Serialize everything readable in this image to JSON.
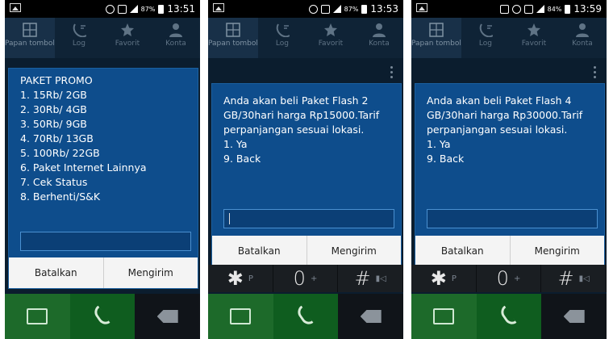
{
  "phones": [
    {
      "status": {
        "battery": "87%",
        "time": "13:51"
      },
      "tabs": [
        "Papan tombol",
        "Log",
        "Favorit",
        "Konta"
      ],
      "dialog": {
        "message": "PAKET PROMO\n1. 15Rb/ 2GB\n2. 30Rb/ 4GB\n3. 50Rb/ 9GB\n4. 70Rb/ 13GB\n5. 100Rb/ 22GB\n6. Paket Internet Lainnya\n7. Cek Status\n8. Berhenti/S&K",
        "input_value": "",
        "cancel_label": "Batalkan",
        "send_label": "Mengirim"
      }
    },
    {
      "status": {
        "battery": "87%",
        "time": "13:53"
      },
      "tabs": [
        "Papan tombol",
        "Log",
        "Favorit",
        "Konta"
      ],
      "dialog": {
        "message": "Anda akan beli Paket Flash 2 GB/30hari harga Rp15000.Tarif perpanjangan sesuai lokasi.\n1. Ya\n9. Back",
        "input_value": "",
        "cancel_label": "Batalkan",
        "send_label": "Mengirim"
      },
      "keypad": [
        {
          "main": "✱",
          "sub": "P"
        },
        {
          "main": "0",
          "sub": "+"
        },
        {
          "main": "#",
          "sub": ""
        }
      ]
    },
    {
      "status": {
        "battery": "84%",
        "time": "13:59"
      },
      "tabs": [
        "Papan tombol",
        "Log",
        "Favorit",
        "Konta"
      ],
      "dialog": {
        "message": "Anda akan beli Paket Flash 4 GB/30hari harga Rp30000.Tarif perpanjangan sesuai lokasi.\n1. Ya\n9. Back",
        "input_value": "",
        "cancel_label": "Batalkan",
        "send_label": "Mengirim"
      },
      "keypad": [
        {
          "main": "✱",
          "sub": "P"
        },
        {
          "main": "0",
          "sub": "+"
        },
        {
          "main": "#",
          "sub": ""
        }
      ]
    }
  ],
  "colors": {
    "dialog_bg": "#0e4d8c",
    "dialer_bg": "#0b1d2e",
    "call_green": "#0f5d1f"
  }
}
